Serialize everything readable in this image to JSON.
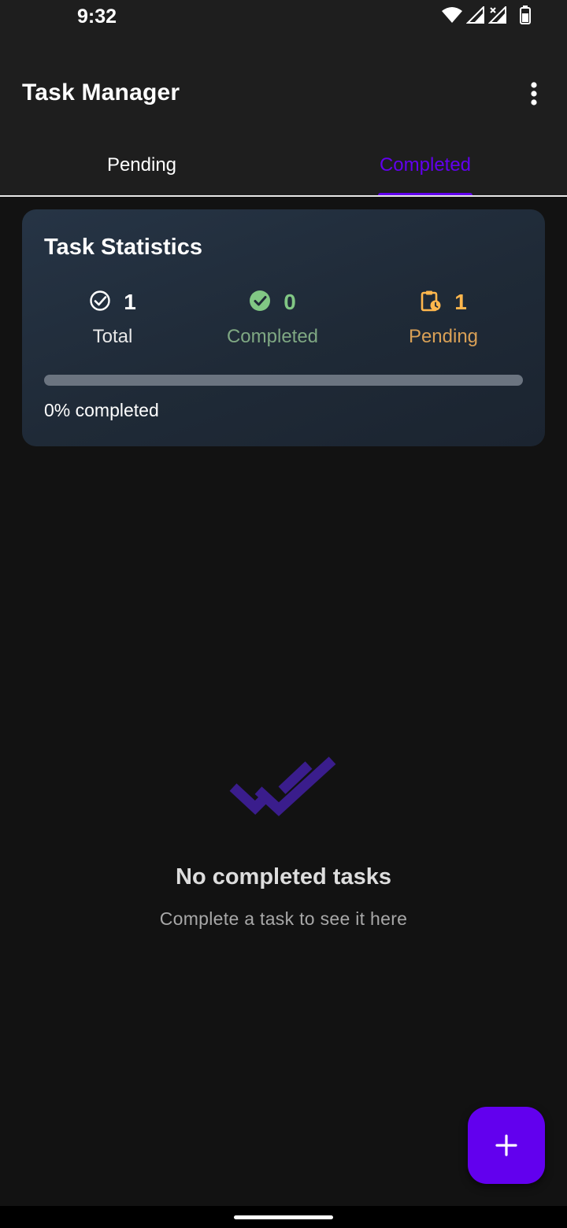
{
  "status_bar": {
    "time": "9:32",
    "icons": [
      "wifi-icon",
      "signal-icon",
      "signal-icon",
      "battery-icon"
    ]
  },
  "app_bar": {
    "title": "Task Manager",
    "more_icon": "more-vert-icon"
  },
  "tabs": [
    {
      "label": "Pending",
      "selected": false
    },
    {
      "label": "Completed",
      "selected": true
    }
  ],
  "stats": {
    "title": "Task Statistics",
    "total": {
      "value": "1",
      "label": "Total",
      "icon": "check-circle-outline-icon"
    },
    "completed": {
      "value": "0",
      "label": "Completed",
      "icon": "check-circle-icon"
    },
    "pending": {
      "value": "1",
      "label": "Pending",
      "icon": "pending-actions-icon"
    },
    "progress_fraction": 0,
    "progress_text": "0% completed"
  },
  "empty_state": {
    "icon": "done-all-icon",
    "title": "No completed tasks",
    "subtitle": "Complete a task to see it here"
  },
  "fab": {
    "icon": "add-icon"
  },
  "colors": {
    "accent": "#6200ee",
    "completed": "#81c784",
    "pending": "#ffb74d",
    "background": "#121212",
    "surface": "#1e1e1e"
  }
}
